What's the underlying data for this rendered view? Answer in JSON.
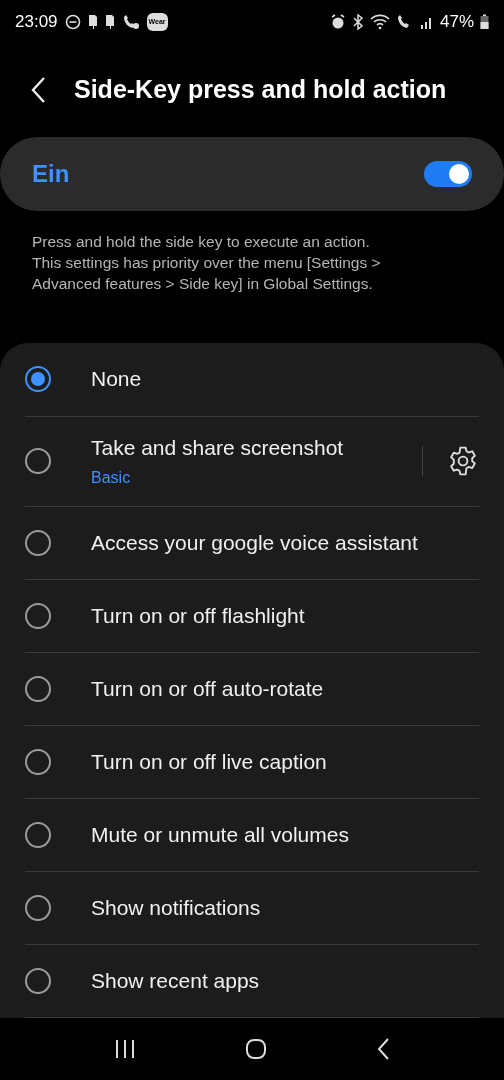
{
  "status_bar": {
    "time": "23:09",
    "badge": "Wear",
    "battery": "47%"
  },
  "header": {
    "title": "Side-Key press and hold action"
  },
  "master_switch": {
    "label": "Ein",
    "on": true
  },
  "description": "Press and hold the side key to execute an action.\nThis settings has priority over the menu [Settings >\nAdvanced features > Side key] in Global Settings.",
  "options": [
    {
      "label": "None",
      "selected": true
    },
    {
      "label": "Take and share screenshot",
      "subtitle": "Basic",
      "selected": false,
      "has_settings": true
    },
    {
      "label": "Access your google voice assistant",
      "selected": false
    },
    {
      "label": "Turn on or off flashlight",
      "selected": false
    },
    {
      "label": "Turn on or off auto-rotate",
      "selected": false
    },
    {
      "label": "Turn on or off live caption",
      "selected": false
    },
    {
      "label": "Mute or unmute all volumes",
      "selected": false
    },
    {
      "label": "Show notifications",
      "selected": false
    },
    {
      "label": "Show recent apps",
      "selected": false
    }
  ]
}
